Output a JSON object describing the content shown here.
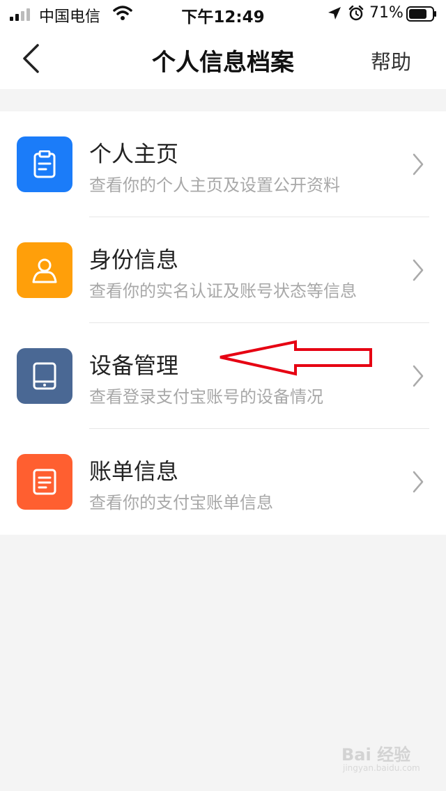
{
  "status_bar": {
    "carrier": "中国电信",
    "time": "下午12:49",
    "battery": "71%"
  },
  "nav": {
    "title": "个人信息档案",
    "help": "帮助"
  },
  "items": [
    {
      "title": "个人主页",
      "subtitle": "查看你的个人主页及设置公开资料",
      "icon": "clipboard-icon",
      "color": "#1b7cf9"
    },
    {
      "title": "身份信息",
      "subtitle": "查看你的实名认证及账号状态等信息",
      "icon": "person-icon",
      "color": "#ff9f0a"
    },
    {
      "title": "设备管理",
      "subtitle": "查看登录支付宝账号的设备情况",
      "icon": "tablet-icon",
      "color": "#4a6894"
    },
    {
      "title": "账单信息",
      "subtitle": "查看你的支付宝账单信息",
      "icon": "document-icon",
      "color": "#ff5f30"
    }
  ],
  "watermark": {
    "text": "Bai 经验",
    "sub": "jingyan.baidu.com"
  },
  "annotation_color": "#e60012"
}
